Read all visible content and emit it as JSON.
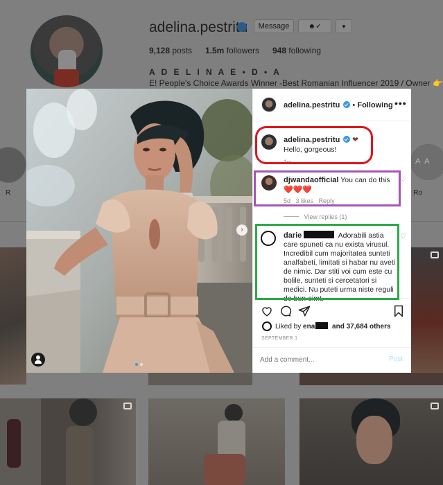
{
  "profile": {
    "username": "adelina.pestritu",
    "message_button": "Message",
    "stats": [
      {
        "value": "9,128",
        "label": "posts"
      },
      {
        "value": "1.5m",
        "label": "followers"
      },
      {
        "value": "948",
        "label": "following"
      }
    ],
    "full_name": "A D E L I N A E • D • A",
    "bio": "E! People's Choice Awards Winner -Best Romanian Influencer 2019 / Owner",
    "highlights_visible_labels": [
      "R",
      "r Ro"
    ],
    "highlight_badge_text": "A A"
  },
  "post": {
    "author": "adelina.pestritu",
    "following_label": "Following",
    "caption": "Hello, gorgeous!",
    "caption_time": "1w",
    "comments": [
      {
        "username": "djwandaofficial",
        "text": "You can do this",
        "emoji": "❤️❤️❤️",
        "time": "5d",
        "likes": "3 likes",
        "reply": "Reply",
        "view_replies": "View replies (1)"
      },
      {
        "username": "darie",
        "text": "Adorabili astia care spuneti ca nu exista virusul. Incredibil cum majoritatea sunteti analfabeti, limitati si habar nu aveti de nimic. Dar stiti voi cum este cu bolile, sunteti si cercetatori si medici. Nu puteti urma niste reguli de bun-simt."
      }
    ],
    "liked_by_prefix": "Liked by",
    "liked_by_user": "ena",
    "liked_by_suffix": "and 37,684 others",
    "date": "SEPTEMBER 1",
    "comment_placeholder": "Add a comment...",
    "post_button": "Post"
  },
  "colors": {
    "annotation_red": "#e0151c",
    "annotation_purple": "#a554b5",
    "annotation_green": "#2ea84a",
    "link_blue": "#3897f0",
    "verified_blue": "#3897f0",
    "heart_red": "#ed4956"
  },
  "icons": [
    "verified-icon",
    "more-options-icon",
    "heart-icon",
    "comment-icon",
    "share-icon",
    "bookmark-icon",
    "next-arrow-icon",
    "user-tag-icon",
    "follow-dropdown-icon",
    "chevron-down-icon"
  ]
}
